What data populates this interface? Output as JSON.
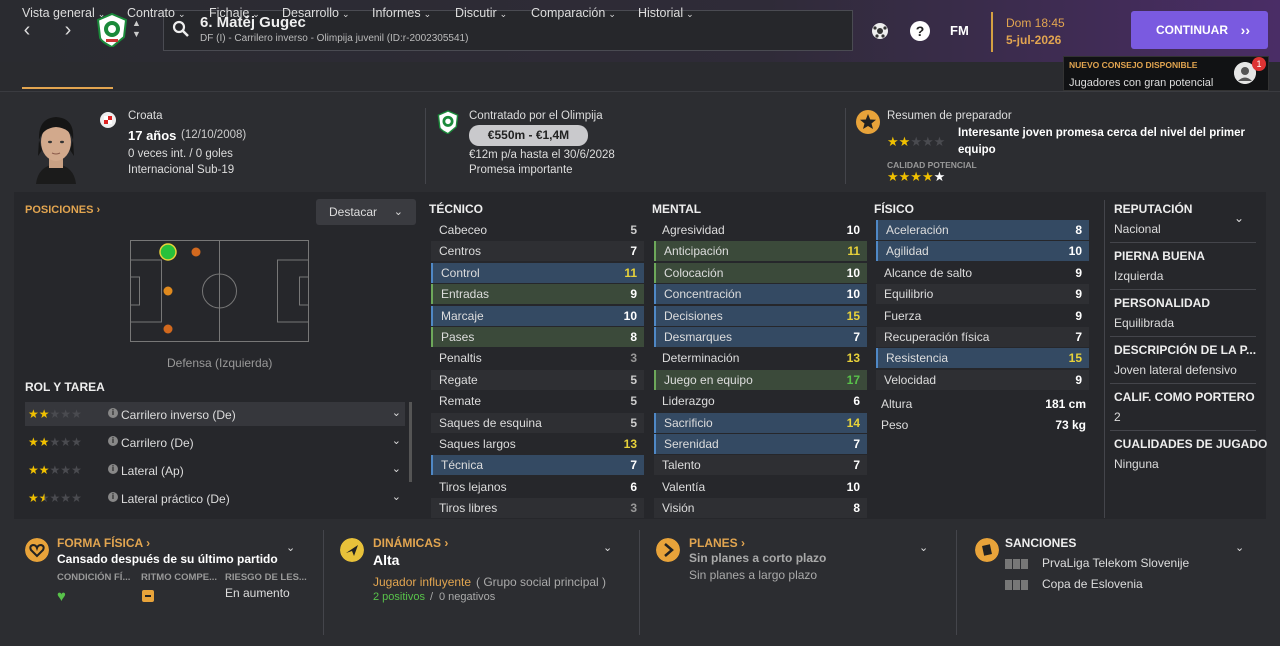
{
  "header": {
    "player_name": "6. Matěj Gugec",
    "player_sub": "DF (I) - Carrilero inverso - Olimpija juvenil (ID:r-2002305541)",
    "fm_logo": "FM",
    "date_day": "Dom 18:45",
    "date_date": "5-jul-2026",
    "continue_label": "CONTINUAR"
  },
  "tabs": [
    "Vista general",
    "Contrato",
    "Fichaje",
    "Desarrollo",
    "Informes",
    "Discutir",
    "Comparación",
    "Historial"
  ],
  "advice": {
    "title": "NUEVO CONSEJO DISPONIBLE",
    "text": "Jugadores con gran potencial",
    "count": "1"
  },
  "profile": {
    "nationality": "Croata",
    "age": "17 años",
    "dob": "(12/10/2008)",
    "caps": "0 veces int. / 0 goles",
    "intl": "Internacional Sub-19",
    "contract_title": "Contratado por el Olimpija",
    "value": "€550m - €1,4M",
    "wage": "€12m p/a hasta el 30/6/2028",
    "status": "Promesa importante",
    "coach_title": "Resumen de preparador",
    "coach_text_1": "Interesante joven promesa cerca del nivel del primer",
    "coach_text_2": "equipo",
    "current_stars": 2,
    "potential_label": "CALIDAD POTENCIAL",
    "potential_stars": 4.5
  },
  "positions": {
    "title": "POSICIONES",
    "highlight_label": "Destacar",
    "position_label": "Defensa (Izquierda)",
    "role_title": "ROL Y TAREA",
    "roles": [
      {
        "label": "Carrilero inverso (De)",
        "stars": 2
      },
      {
        "label": "Carrilero (De)",
        "stars": 2
      },
      {
        "label": "Lateral (Ap)",
        "stars": 2
      },
      {
        "label": "Lateral práctico (De)",
        "stars": 1.5
      }
    ]
  },
  "technical": {
    "title": "TÉCNICO",
    "attrs": [
      {
        "name": "Cabeceo",
        "value": "5"
      },
      {
        "name": "Centros",
        "value": "7"
      },
      {
        "name": "Control",
        "value": "11"
      },
      {
        "name": "Entradas",
        "value": "9"
      },
      {
        "name": "Marcaje",
        "value": "10"
      },
      {
        "name": "Pases",
        "value": "8"
      },
      {
        "name": "Penaltis",
        "value": "3"
      },
      {
        "name": "Regate",
        "value": "5"
      },
      {
        "name": "Remate",
        "value": "5"
      },
      {
        "name": "Saques de esquina",
        "value": "5"
      },
      {
        "name": "Saques largos",
        "value": "13"
      },
      {
        "name": "Técnica",
        "value": "7"
      },
      {
        "name": "Tiros lejanos",
        "value": "6"
      },
      {
        "name": "Tiros libres",
        "value": "3"
      }
    ]
  },
  "mental": {
    "title": "MENTAL",
    "attrs": [
      {
        "name": "Agresividad",
        "value": "10"
      },
      {
        "name": "Anticipación",
        "value": "11"
      },
      {
        "name": "Colocación",
        "value": "10"
      },
      {
        "name": "Concentración",
        "value": "10"
      },
      {
        "name": "Decisiones",
        "value": "15"
      },
      {
        "name": "Desmarques",
        "value": "7"
      },
      {
        "name": "Determinación",
        "value": "13"
      },
      {
        "name": "Juego en equipo",
        "value": "17"
      },
      {
        "name": "Liderazgo",
        "value": "6"
      },
      {
        "name": "Sacrificio",
        "value": "14"
      },
      {
        "name": "Serenidad",
        "value": "7"
      },
      {
        "name": "Talento",
        "value": "7"
      },
      {
        "name": "Valentía",
        "value": "10"
      },
      {
        "name": "Visión",
        "value": "8"
      }
    ]
  },
  "physical": {
    "title": "FÍSICO",
    "attrs": [
      {
        "name": "Aceleración",
        "value": "8"
      },
      {
        "name": "Agilidad",
        "value": "10"
      },
      {
        "name": "Alcance de salto",
        "value": "9"
      },
      {
        "name": "Equilibrio",
        "value": "9"
      },
      {
        "name": "Fuerza",
        "value": "9"
      },
      {
        "name": "Recuperación física",
        "value": "7"
      },
      {
        "name": "Resistencia",
        "value": "15"
      },
      {
        "name": "Velocidad",
        "value": "9"
      }
    ],
    "height_label": "Altura",
    "height": "181 cm",
    "weight_label": "Peso",
    "weight": "73 kg"
  },
  "side": [
    {
      "title": "REPUTACIÓN",
      "value": "Nacional"
    },
    {
      "title": "PIERNA BUENA",
      "value": "Izquierda"
    },
    {
      "title": "PERSONALIDAD",
      "value": "Equilibrada"
    },
    {
      "title": "DESCRIPCIÓN DE LA P...",
      "value": "Joven lateral defensivo"
    },
    {
      "title": "CALIF. COMO PORTERO",
      "value": "2"
    },
    {
      "title": "CUALIDADES DE JUGADO",
      "value": "Ninguna"
    }
  ],
  "bottom": {
    "form": {
      "title": "FORMA FÍSICA",
      "text": "Cansado después de su último partido",
      "h1": "CONDICIÓN FÍ...",
      "h2": "RITMO COMPE...",
      "h3": "RIESGO DE LES...",
      "risk": "En aumento"
    },
    "dynamics": {
      "title": "DINÁMICAS",
      "level": "Alta",
      "influence": "Jugador influyente",
      "group": "( Grupo social principal )",
      "positives": "2 positivos",
      "slash": "/",
      "negatives": "0 negativos"
    },
    "plans": {
      "title": "PLANES",
      "short": "Sin planes a corto plazo",
      "long": "Sin planes a largo plazo"
    },
    "sanctions": {
      "title": "SANCIONES",
      "comp1": "PrvaLiga Telekom Slovenije",
      "comp2": "Copa de Eslovenia"
    }
  },
  "colors": {
    "accent": "#e2a550",
    "button": "#7a5ae0",
    "highlight_blue": "#344a63",
    "highlight_green": "#3b4a3a",
    "value_yellow": "#e8d23a",
    "value_green": "#58c24a"
  }
}
